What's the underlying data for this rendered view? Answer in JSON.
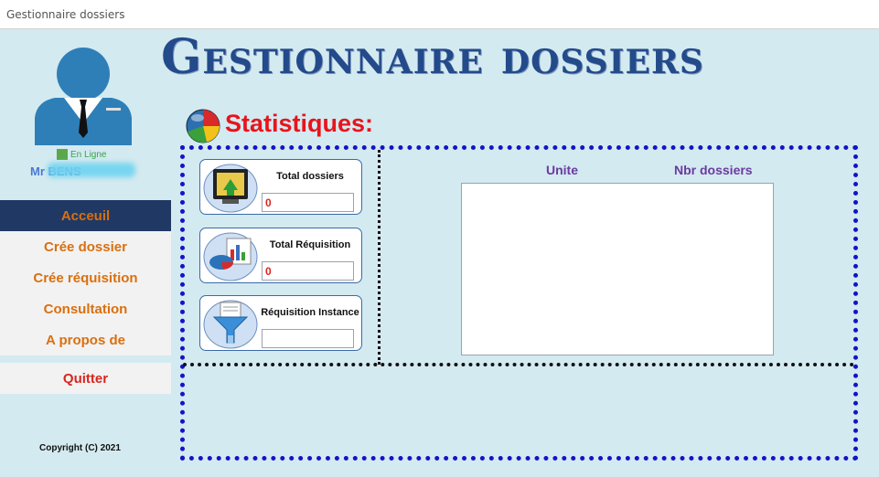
{
  "window": {
    "title": "Gestionnaire dossiers"
  },
  "app": {
    "title": "Gestionnaire dossiers"
  },
  "user": {
    "status": "En Ligne",
    "name": "Mr BENS"
  },
  "nav": {
    "items": [
      {
        "label": "Acceuil",
        "active": true
      },
      {
        "label": "Crée dossier"
      },
      {
        "label": "Crée réquisition"
      },
      {
        "label": "Consultation"
      },
      {
        "label": "A propos de"
      }
    ],
    "quit_label": "Quitter"
  },
  "footer": {
    "copyright": "Copyright (C) 2021"
  },
  "stats": {
    "title": "Statistiques:",
    "cards": [
      {
        "label": "Total dossiers",
        "value": "0"
      },
      {
        "label": "Total Réquisition",
        "value": "0"
      },
      {
        "label": "Réquisition Instance",
        "value": ""
      }
    ],
    "table": {
      "columns": [
        "Unite",
        "Nbr dossiers"
      ],
      "rows": []
    }
  },
  "colors": {
    "nav_active": "#203864",
    "nav_text": "#d9700f",
    "quit": "#d8261f",
    "title": "#234a8a",
    "stats_title": "#e8141c",
    "panel_border": "#1313c8"
  },
  "icons": [
    "user-avatar-icon",
    "pie-chart-globe-icon",
    "monitor-chart-icon",
    "report-chart-icon",
    "filter-funnel-icon"
  ]
}
